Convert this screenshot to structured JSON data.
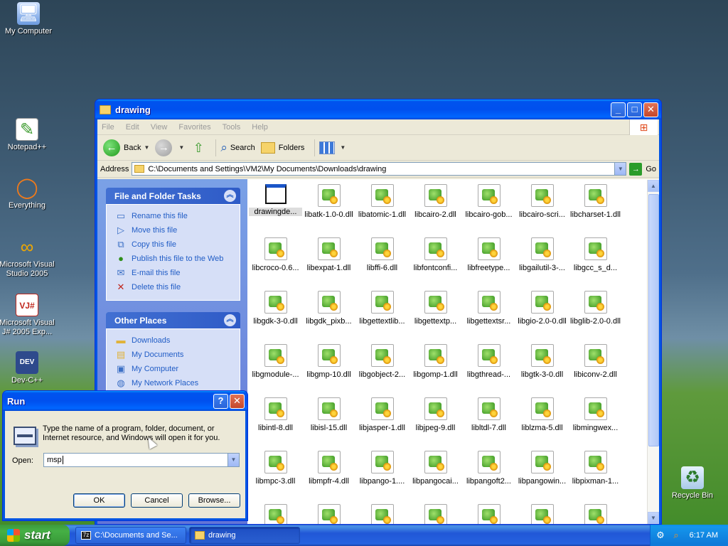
{
  "desktop": {
    "icons": [
      {
        "label": "My Computer",
        "icon": "computer-icon"
      },
      {
        "label": "Notepad++",
        "icon": "notepad-icon"
      },
      {
        "label": "Everything",
        "icon": "search-ring-icon"
      },
      {
        "label": "Microsoft Visual Studio 2005",
        "icon": "visual-studio-icon"
      },
      {
        "label": "Microsoft Visual J# 2005 Exp...",
        "icon": "vj-icon"
      },
      {
        "label": "Dev-C++",
        "icon": "devcpp-icon"
      },
      {
        "label": "Recycle Bin",
        "icon": "recycle-bin-icon"
      }
    ]
  },
  "explorer": {
    "title": "drawing",
    "menu": [
      "File",
      "Edit",
      "View",
      "Favorites",
      "Tools",
      "Help"
    ],
    "toolbar": {
      "back_label": "Back",
      "search_label": "Search",
      "folders_label": "Folders"
    },
    "address": {
      "label": "Address",
      "value": "C:\\Documents and Settings\\VM2\\My Documents\\Downloads\\drawing",
      "go_label": "Go"
    },
    "file_tasks": {
      "title": "File and Folder Tasks",
      "items": [
        {
          "label": "Rename this file",
          "icon": "rename-icon"
        },
        {
          "label": "Move this file",
          "icon": "move-icon"
        },
        {
          "label": "Copy this file",
          "icon": "copy-icon"
        },
        {
          "label": "Publish this file to the Web",
          "icon": "globe-icon"
        },
        {
          "label": "E-mail this file",
          "icon": "email-icon"
        },
        {
          "label": "Delete this file",
          "icon": "delete-icon"
        }
      ]
    },
    "other_places": {
      "title": "Other Places",
      "items": [
        {
          "label": "Downloads",
          "icon": "folder-icon"
        },
        {
          "label": "My Documents",
          "icon": "my-documents-icon"
        },
        {
          "label": "My Computer",
          "icon": "computer-icon"
        },
        {
          "label": "My Network Places",
          "icon": "network-icon"
        }
      ]
    },
    "files": [
      {
        "name": "drawingde...",
        "type": "exe"
      },
      {
        "name": "libatk-1.0-0.dll",
        "type": "dll"
      },
      {
        "name": "libatomic-1.dll",
        "type": "dll"
      },
      {
        "name": "libcairo-2.dll",
        "type": "dll"
      },
      {
        "name": "libcairo-gob...",
        "type": "dll"
      },
      {
        "name": "libcairo-scri...",
        "type": "dll"
      },
      {
        "name": "libcharset-1.dll",
        "type": "dll"
      },
      {
        "name": "libcroco-0.6...",
        "type": "dll"
      },
      {
        "name": "libexpat-1.dll",
        "type": "dll"
      },
      {
        "name": "libffi-6.dll",
        "type": "dll"
      },
      {
        "name": "libfontconfi...",
        "type": "dll"
      },
      {
        "name": "libfreetype...",
        "type": "dll"
      },
      {
        "name": "libgailutil-3-...",
        "type": "dll"
      },
      {
        "name": "libgcc_s_d...",
        "type": "dll"
      },
      {
        "name": "libgdk-3-0.dll",
        "type": "dll"
      },
      {
        "name": "libgdk_pixb...",
        "type": "dll"
      },
      {
        "name": "libgettextlib...",
        "type": "dll"
      },
      {
        "name": "libgettextp...",
        "type": "dll"
      },
      {
        "name": "libgettextsr...",
        "type": "dll"
      },
      {
        "name": "libgio-2.0-0.dll",
        "type": "dll"
      },
      {
        "name": "libglib-2.0-0.dll",
        "type": "dll"
      },
      {
        "name": "libgmodule-...",
        "type": "dll"
      },
      {
        "name": "libgmp-10.dll",
        "type": "dll"
      },
      {
        "name": "libgobject-2...",
        "type": "dll"
      },
      {
        "name": "libgomp-1.dll",
        "type": "dll"
      },
      {
        "name": "libgthread-...",
        "type": "dll"
      },
      {
        "name": "libgtk-3-0.dll",
        "type": "dll"
      },
      {
        "name": "libiconv-2.dll",
        "type": "dll"
      },
      {
        "name": "libintl-8.dll",
        "type": "dll"
      },
      {
        "name": "libisl-15.dll",
        "type": "dll"
      },
      {
        "name": "libjasper-1.dll",
        "type": "dll"
      },
      {
        "name": "libjpeg-9.dll",
        "type": "dll"
      },
      {
        "name": "libltdl-7.dll",
        "type": "dll"
      },
      {
        "name": "liblzma-5.dll",
        "type": "dll"
      },
      {
        "name": "libmingwex...",
        "type": "dll"
      },
      {
        "name": "libmpc-3.dll",
        "type": "dll"
      },
      {
        "name": "libmpfr-4.dll",
        "type": "dll"
      },
      {
        "name": "libpango-1....",
        "type": "dll"
      },
      {
        "name": "libpangocai...",
        "type": "dll"
      },
      {
        "name": "libpangoft2...",
        "type": "dll"
      },
      {
        "name": "libpangowin...",
        "type": "dll"
      },
      {
        "name": "libpixman-1...",
        "type": "dll"
      },
      {
        "name": "",
        "type": "dll"
      },
      {
        "name": "",
        "type": "dll"
      },
      {
        "name": "",
        "type": "dll"
      },
      {
        "name": "",
        "type": "dll"
      },
      {
        "name": "",
        "type": "dll"
      },
      {
        "name": "",
        "type": "dll"
      },
      {
        "name": "",
        "type": "dll"
      }
    ]
  },
  "run_dialog": {
    "title": "Run",
    "description": "Type the name of a program, folder, document, or Internet resource, and Windows will open it for you.",
    "open_label": "Open:",
    "open_value": "msp",
    "ok_label": "OK",
    "cancel_label": "Cancel",
    "browse_label": "Browse..."
  },
  "taskbar": {
    "start_label": "start",
    "buttons": [
      {
        "label": "C:\\Documents and Se...",
        "icon": "console-icon",
        "active": false
      },
      {
        "label": "drawing",
        "icon": "folder-icon",
        "active": true
      }
    ],
    "clock": "6:17 AM"
  },
  "colors": {
    "xp_blue": "#0054e3",
    "task_link": "#215dc6",
    "start_green": "#3c9a3c"
  }
}
